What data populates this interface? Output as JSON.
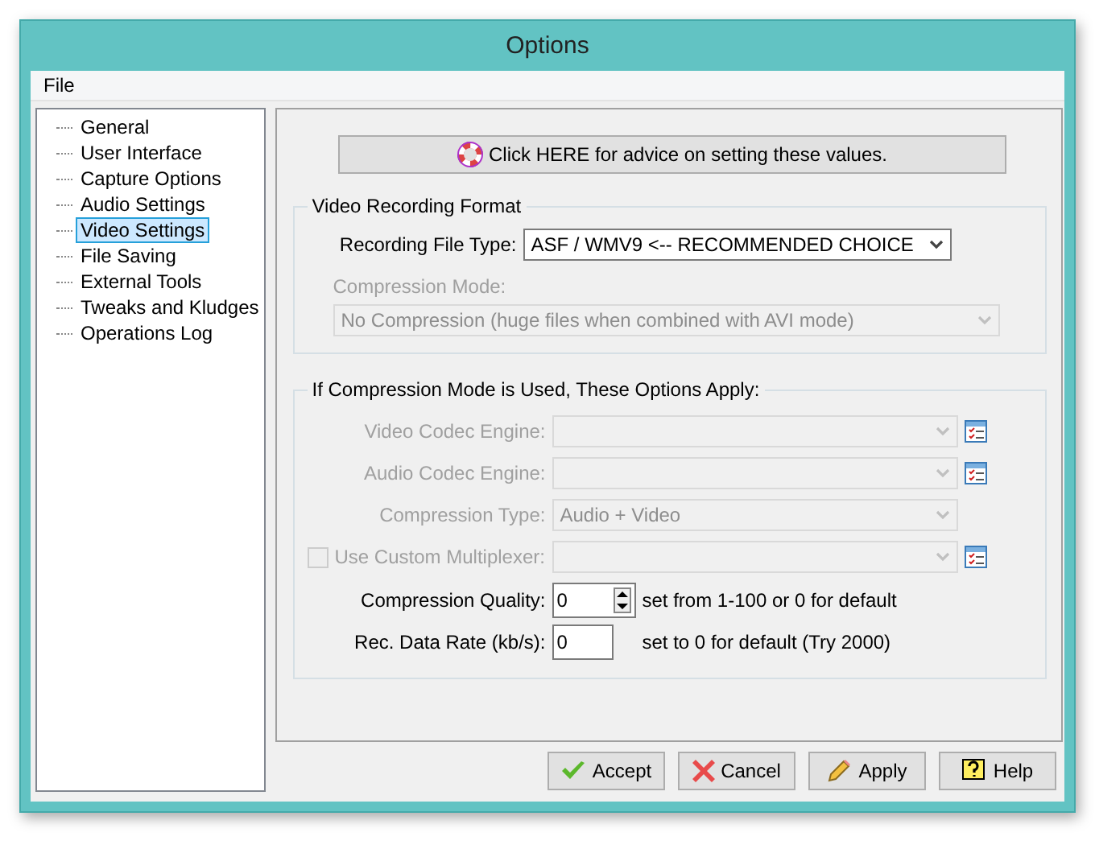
{
  "window": {
    "title": "Options"
  },
  "menu": [
    "File"
  ],
  "tree": [
    {
      "label": "General",
      "selected": false
    },
    {
      "label": "User Interface",
      "selected": false
    },
    {
      "label": "Capture Options",
      "selected": false
    },
    {
      "label": "Audio Settings",
      "selected": false
    },
    {
      "label": "Video Settings",
      "selected": true
    },
    {
      "label": "File Saving",
      "selected": false
    },
    {
      "label": "External Tools",
      "selected": false
    },
    {
      "label": "Tweaks and Kludges",
      "selected": false
    },
    {
      "label": "Operations Log",
      "selected": false
    }
  ],
  "advice_button": "Click HERE for advice on setting these values.",
  "format_group": {
    "title": "Video Recording Format",
    "file_type_label": "Recording File Type:",
    "file_type_value": "ASF / WMV9 <-- RECOMMENDED CHOICE",
    "mode_label": "Compression Mode:",
    "mode_value": "No Compression (huge files when combined with AVI mode)",
    "mode_disabled": true
  },
  "compression_group": {
    "title": "If Compression Mode is Used, These Options Apply:",
    "rows": [
      {
        "kind": "select",
        "label": "Video Codec Engine:",
        "disabled": true,
        "picker": true
      },
      {
        "kind": "select",
        "label": "Audio Codec Engine:",
        "disabled": true,
        "picker": true
      },
      {
        "kind": "select",
        "label": "Compression Type:",
        "value": "Audio + Video",
        "disabled": true,
        "picker": false
      },
      {
        "kind": "checkbox-select",
        "label": "Use Custom Multiplexer:",
        "checked": false,
        "disabled": true,
        "picker": true
      },
      {
        "kind": "spin",
        "label": "Compression Quality:",
        "value": "0",
        "hint": "set from 1-100 or 0 for default",
        "disabled": false
      },
      {
        "kind": "number",
        "label": "Rec. Data Rate (kb/s):",
        "value": "0",
        "hint": "set to 0 for default (Try 2000)",
        "disabled": false
      }
    ]
  },
  "buttons": [
    {
      "kind": "accept",
      "label": "Accept"
    },
    {
      "kind": "cancel",
      "label": "Cancel"
    },
    {
      "kind": "apply",
      "label": "Apply"
    },
    {
      "kind": "help",
      "label": "Help"
    }
  ]
}
